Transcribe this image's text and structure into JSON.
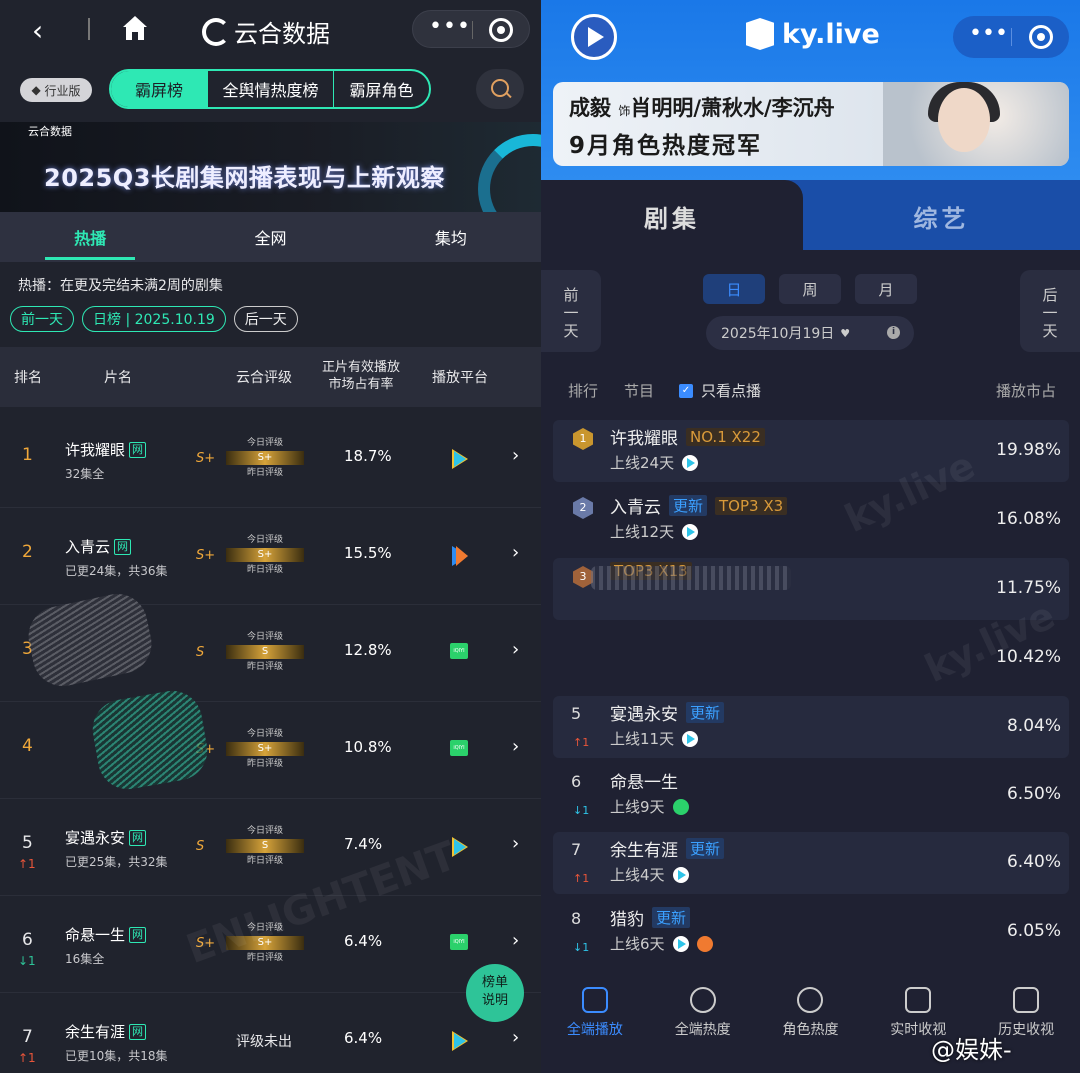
{
  "left": {
    "app_title": "云合数据",
    "industry_badge": "行业版",
    "top_tabs": [
      "霸屏榜",
      "全舆情热度榜",
      "霸屏角色"
    ],
    "banner_logo": "云合数据\nENLIGHTENT",
    "banner_title": "2025Q3长剧集网播表现与上新观察",
    "sub_tabs": [
      "热播",
      "全网",
      "集均"
    ],
    "note": "热播：在更及完结未满2周的剧集",
    "prev_day": "前一天",
    "date_pill": "日榜 | 2025.10.19",
    "next_day": "后一天",
    "headers": {
      "rank": "排名",
      "title": "片名",
      "rating": "云合评级",
      "share": "正片有效播放\n市场占有率",
      "platform": "播放平台"
    },
    "rating_today": "今日评级",
    "rating_yesterday": "昨日评级",
    "web_tag": "网",
    "rows": [
      {
        "rank": "1",
        "title": "许我耀眼",
        "eps": "32集全",
        "grade": "S+",
        "today": "S+",
        "yesterday": "",
        "share": "18.7%",
        "platform": "tencent",
        "trend": ""
      },
      {
        "rank": "2",
        "title": "入青云",
        "eps": "已更24集，共36集",
        "grade": "S+",
        "today": "S+",
        "yesterday": "",
        "share": "15.5%",
        "platform": "youku",
        "trend": ""
      },
      {
        "rank": "3",
        "title": "",
        "eps": "",
        "grade": "S",
        "today": "S",
        "yesterday": "",
        "share": "12.8%",
        "platform": "iqiyi",
        "trend": ""
      },
      {
        "rank": "4",
        "title": "",
        "eps": "",
        "grade": "S+",
        "today": "S+",
        "yesterday": "",
        "share": "10.8%",
        "platform": "iqiyi",
        "trend": ""
      },
      {
        "rank": "5",
        "title": "宴遇永安",
        "eps": "已更25集，共32集",
        "grade": "S",
        "today": "S",
        "yesterday": "",
        "share": "7.4%",
        "platform": "tencent",
        "trend": "↑1"
      },
      {
        "rank": "6",
        "title": "命悬一生",
        "eps": "16集全",
        "grade": "S+",
        "today": "S+",
        "yesterday": "",
        "share": "6.4%",
        "platform": "iqiyi",
        "trend": "↓1"
      },
      {
        "rank": "7",
        "title": "余生有涯",
        "eps": "已更10集，共18集",
        "grade": "",
        "today": "",
        "yesterday": "",
        "share": "6.4%",
        "platform": "tencent",
        "trend": "↑1",
        "unrated": "评级未出"
      }
    ],
    "fab": "榜单\n说明"
  },
  "right": {
    "app_title": "ky.live",
    "banner_line1_name": "成毅",
    "banner_line1_role_prefix": "饰",
    "banner_line1_roles": "肖明明/萧秋水/李沉舟",
    "banner_line2": "9月角色热度冠军",
    "tabs": [
      "剧集",
      "综艺"
    ],
    "prev": "前\n一\n天",
    "next": "后\n一\n天",
    "periods": [
      "日",
      "周",
      "月"
    ],
    "date": "2025年10月19日",
    "headers": {
      "rank": "排行",
      "program": "节目",
      "only_vod": "只看点播",
      "share": "播放市占"
    },
    "rows": [
      {
        "rank": "1",
        "title": "许我耀眼",
        "tags": [
          {
            "t": "NO.1 X22",
            "k": "top"
          }
        ],
        "online": "上线24天",
        "share": "19.98%",
        "medal": "#c9962e",
        "trend": ""
      },
      {
        "rank": "2",
        "title": "入青云",
        "tags": [
          {
            "t": "更新",
            "k": "new"
          },
          {
            "t": "TOP3 X3",
            "k": "top"
          }
        ],
        "online": "上线12天",
        "share": "16.08%",
        "medal": "#6a7aa8",
        "trend": ""
      },
      {
        "rank": "3",
        "title": "",
        "tags": [
          {
            "t": "TOP3 X13",
            "k": "top"
          }
        ],
        "online": "",
        "share": "11.75%",
        "medal": "#a0623a",
        "trend": ""
      },
      {
        "rank": "",
        "title": "",
        "tags": [],
        "online": "",
        "share": "10.42%",
        "medal": "",
        "trend": ""
      },
      {
        "rank": "5",
        "title": "宴遇永安",
        "tags": [
          {
            "t": "更新",
            "k": "new"
          }
        ],
        "online": "上线11天",
        "share": "8.04%",
        "medal": "",
        "trend": "↑1"
      },
      {
        "rank": "6",
        "title": "命悬一生",
        "tags": [],
        "online": "上线9天",
        "share": "6.50%",
        "medal": "",
        "trend": "↓1"
      },
      {
        "rank": "7",
        "title": "余生有涯",
        "tags": [
          {
            "t": "更新",
            "k": "new"
          }
        ],
        "online": "上线4天",
        "share": "6.40%",
        "medal": "",
        "trend": "↑1"
      },
      {
        "rank": "8",
        "title": "猎豹",
        "tags": [
          {
            "t": "更新",
            "k": "new"
          }
        ],
        "online": "上线6天",
        "share": "6.05%",
        "medal": "",
        "trend": "↓1"
      }
    ],
    "nav": [
      "全端播放",
      "全端热度",
      "角色热度",
      "实时收视",
      "历史收视"
    ]
  },
  "weibo_mark": "@娱妹-",
  "colors": {
    "left_accent": "#2ee8b4",
    "right_accent": "#3b8cff",
    "gold": "#f0a83a"
  }
}
